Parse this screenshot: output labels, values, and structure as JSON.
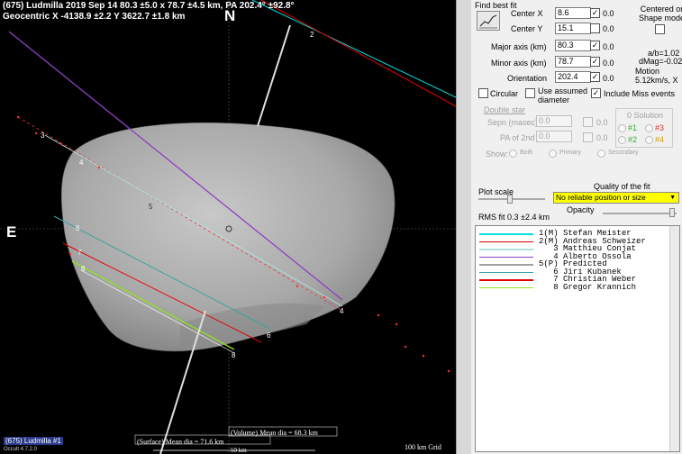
{
  "header": {
    "line1": "(675) Ludmilla  2019 Sep 14   80.3 ±5.0 x 78.7 ±4.5 km, PA 202.4° ±92.8°",
    "line2": "Geocentric  X  -4138.9 ±2.2  Y 3622.7 ±1.8 km"
  },
  "compass": {
    "north": "N",
    "east": "E"
  },
  "footer": {
    "volume": "(Volume) Mean dia = 68.3 km",
    "surface": "(Surface) Mean dia = 71.6 km",
    "scale": "50 km",
    "grid": "100 km Grid",
    "id_label": "(675) Ludmilla  #1",
    "version": "Occult 4.7.2.0"
  },
  "chord_labels": [
    "1",
    "2",
    "3",
    "4",
    "5",
    "6",
    "7",
    "8"
  ],
  "panel": {
    "find_best_fit": "Find best fit",
    "find_icon": "chart-icon",
    "centered_on": "Centered on",
    "shape_model": "Shape model",
    "fields": [
      {
        "label": "Center X",
        "value": "8.6",
        "checked": "✓",
        "extra": "0.0"
      },
      {
        "label": "Center Y",
        "value": "15.1",
        "checked": "",
        "extra": "0.0"
      },
      {
        "label": "Major axis (km)",
        "value": "80.3",
        "checked": "✓",
        "extra": "0.0"
      },
      {
        "label": "Minor axis (km)",
        "value": "78.7",
        "checked": "✓",
        "extra": "0.0"
      },
      {
        "label": "Orientation",
        "value": "202.4",
        "checked": "✓",
        "extra": "0.0"
      }
    ],
    "ratio_ab": "a/b=1.02",
    "dmag": "dMag=-0.02",
    "motion": "Motion",
    "motion_val": "5.12km/s, X",
    "circular": "Circular",
    "use_assumed": "Use assumed",
    "diameter": "diameter",
    "include_miss": "Include Miss events",
    "include_check": "✓",
    "double_star": "Double star",
    "sepn": "Sepn (masec)",
    "sepn_val": "0.0",
    "pa2nd": "PA of 2nd",
    "pa2nd_val": "0.0",
    "zero_a": "0.0",
    "zero_b": "0.0",
    "solution": "0 Solution",
    "sol1": "#1",
    "sol2": "#2",
    "sol3": "#3",
    "sol4": "#4",
    "show": "Show:",
    "both": "Both",
    "primary": "Primary",
    "secondary": "Secondary",
    "plot_scale": "Plot scale",
    "quality": "Quality of the fit",
    "quality_value": "No reliable position or size",
    "dropdown_arrow": "▼",
    "rms": "RMS fit  0.3 ±2.4 km",
    "opacity": "Opacity"
  },
  "legend": [
    {
      "num": "1(M)",
      "name": "Stefan Meister",
      "color": "#00e0e0"
    },
    {
      "num": "2(M)",
      "name": "Andreas Schweizer",
      "color": "#e00000"
    },
    {
      "num": "3",
      "name": "Matthieu Conjat",
      "color": "#b0e0e0"
    },
    {
      "num": "4",
      "name": "Alberto Ossola",
      "color": "#9040c0"
    },
    {
      "num": "5(P)",
      "name": "Predicted",
      "color": "#a0a0a0"
    },
    {
      "num": "6",
      "name": "Jiri Kubanek",
      "color": "#40a0a0"
    },
    {
      "num": "7",
      "name": "Christian Weber",
      "color": "#e00000"
    },
    {
      "num": "8",
      "name": "Gregor Krannich",
      "color": "#90e020"
    }
  ]
}
